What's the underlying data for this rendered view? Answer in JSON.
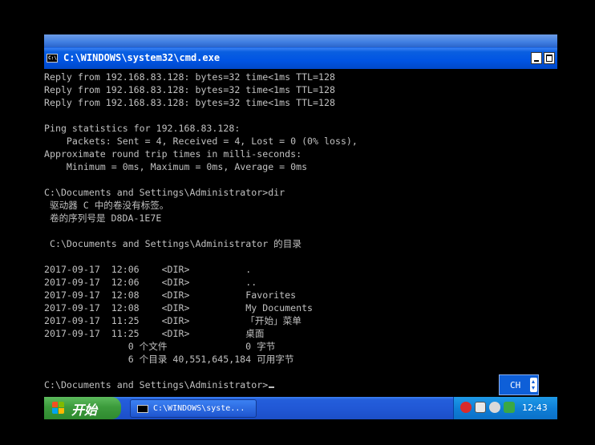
{
  "window": {
    "title": "C:\\WINDOWS\\system32\\cmd.exe",
    "icon": "console-icon"
  },
  "console": {
    "lines": [
      "Reply from 192.168.83.128: bytes=32 time<1ms TTL=128",
      "Reply from 192.168.83.128: bytes=32 time<1ms TTL=128",
      "Reply from 192.168.83.128: bytes=32 time<1ms TTL=128",
      "",
      "Ping statistics for 192.168.83.128:",
      "    Packets: Sent = 4, Received = 4, Lost = 0 (0% loss),",
      "Approximate round trip times in milli-seconds:",
      "    Minimum = 0ms, Maximum = 0ms, Average = 0ms",
      "",
      "C:\\Documents and Settings\\Administrator>dir",
      " 驱动器 C 中的卷没有标签。",
      " 卷的序列号是 D8DA-1E7E",
      "",
      " C:\\Documents and Settings\\Administrator 的目录",
      "",
      "2017-09-17  12:06    <DIR>          .",
      "2017-09-17  12:06    <DIR>          ..",
      "2017-09-17  12:08    <DIR>          Favorites",
      "2017-09-17  12:08    <DIR>          My Documents",
      "2017-09-17  11:25    <DIR>          「开始」菜单",
      "2017-09-17  11:25    <DIR>          桌面",
      "               0 个文件              0 字节",
      "               6 个目录 40,551,645,184 可用字节",
      "",
      "C:\\Documents and Settings\\Administrator>"
    ]
  },
  "taskbar": {
    "start_label": "开始",
    "task_label": "C:\\WINDOWS\\syste...",
    "clock": "12:43"
  },
  "ime": {
    "label": "CH"
  },
  "colors": {
    "title_blue": "#0054e3",
    "taskbar_blue": "#245edb",
    "start_green": "#3c9b3c",
    "tray_blue": "#0f7fd7",
    "console_text": "#c0c0c0"
  }
}
